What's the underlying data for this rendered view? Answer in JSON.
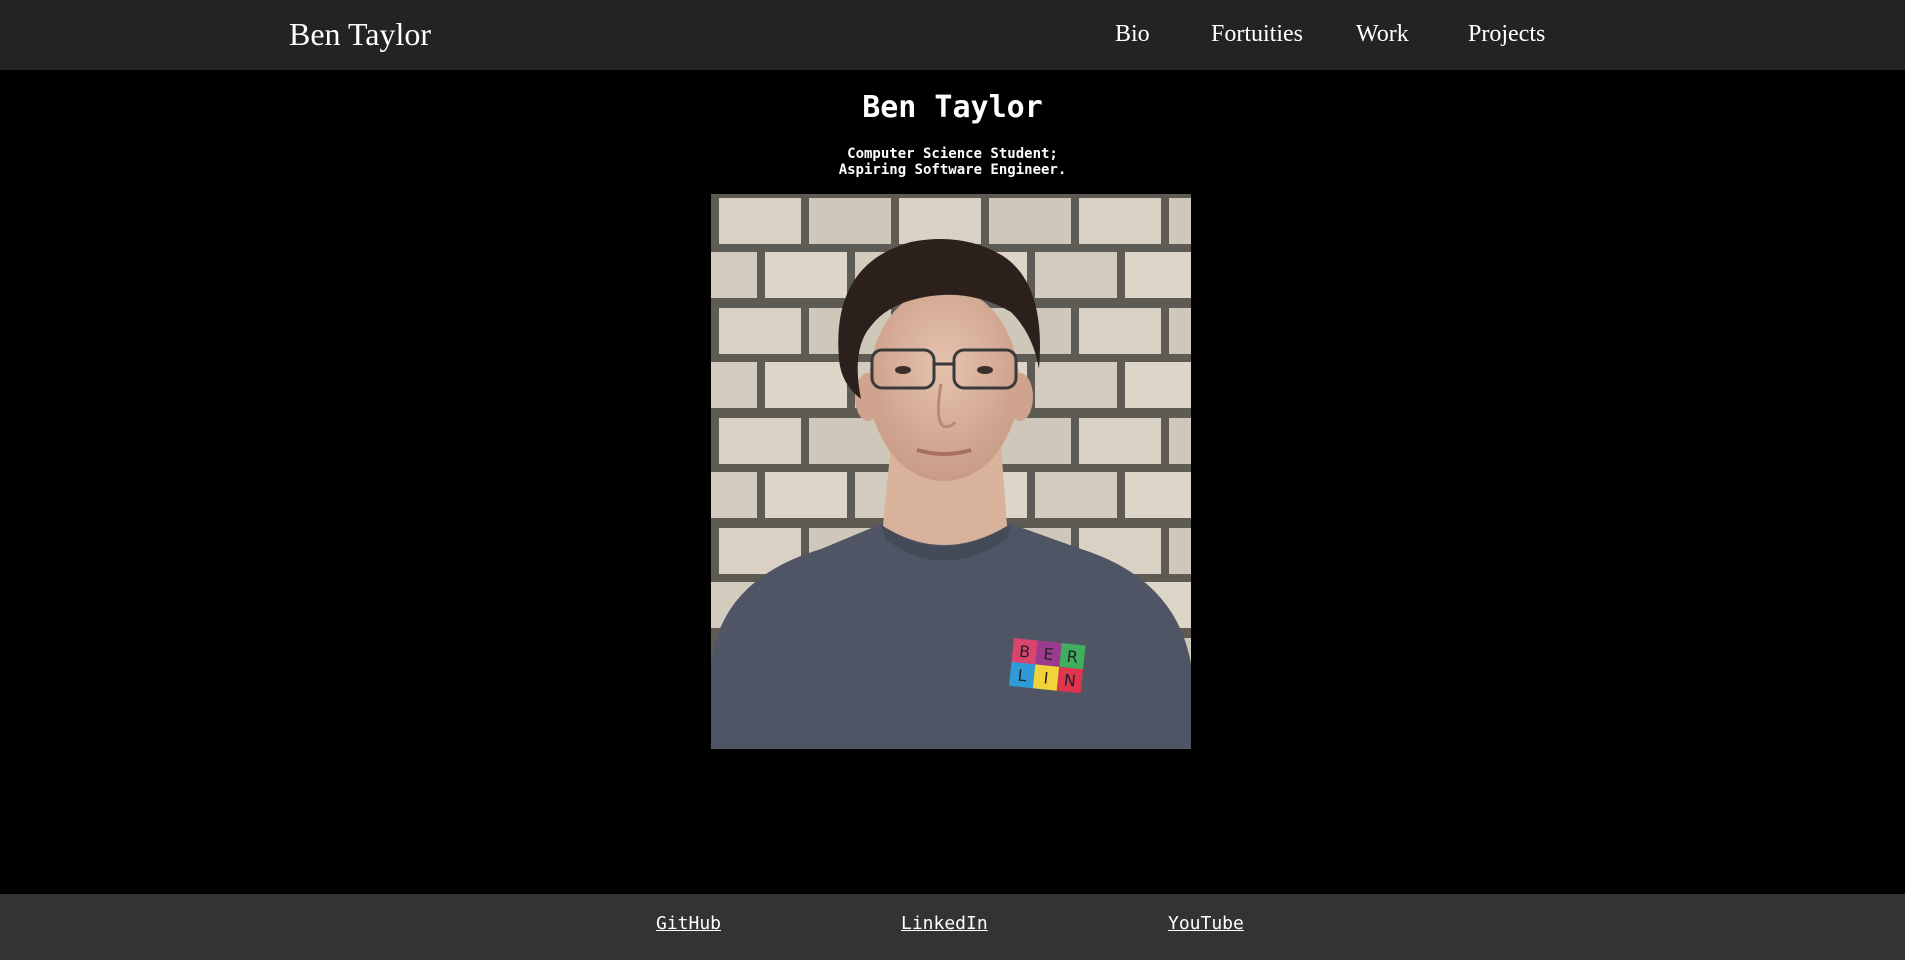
{
  "header": {
    "brand": "Ben Taylor",
    "nav": [
      {
        "label": "Bio"
      },
      {
        "label": "Fortuities"
      },
      {
        "label": "Work"
      },
      {
        "label": "Projects"
      }
    ]
  },
  "hero": {
    "title": "Ben Taylor",
    "subtitle_line1": "Computer Science Student;",
    "subtitle_line2": "Aspiring Software Engineer."
  },
  "portrait": {
    "shirt_text": [
      "B",
      "E",
      "R",
      "L",
      "I",
      "N"
    ]
  },
  "footer": {
    "links": [
      {
        "label": "GitHub"
      },
      {
        "label": "LinkedIn"
      },
      {
        "label": "YouTube"
      }
    ]
  },
  "colors": {
    "page_background": "#000000",
    "navbar_background": "#232323",
    "footer_background": "#333333",
    "text": "#ffffff"
  }
}
